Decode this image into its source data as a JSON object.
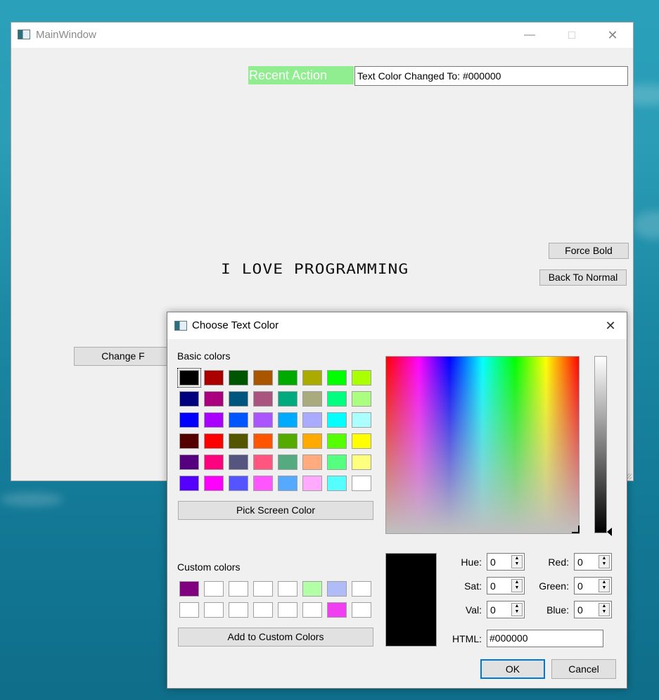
{
  "main_window": {
    "title": "MainWindow",
    "controls": {
      "minimize": "—",
      "maximize": "☐",
      "close": "✕"
    },
    "recent_action_label": "Recent Action",
    "recent_action_value": "Text Color Changed To: #000000",
    "force_bold_label": "Force Bold",
    "back_to_normal_label": "Back To Normal",
    "display_text": "I LOVE PROGRAMMING",
    "change_font_label": "Change F"
  },
  "dialog": {
    "title": "Choose Text Color",
    "close": "✕",
    "basic_colors_label": "Basic colors",
    "basic_colors": [
      "#000000",
      "#aa0000",
      "#005500",
      "#aa5500",
      "#00aa00",
      "#aaaa00",
      "#00ff00",
      "#aaff00",
      "#00007f",
      "#aa007f",
      "#00557f",
      "#aa557f",
      "#00aa7f",
      "#aaaa7f",
      "#00ff7f",
      "#aaff7f",
      "#0000ff",
      "#aa00ff",
      "#0055ff",
      "#aa55ff",
      "#00aaff",
      "#aaaaff",
      "#00ffff",
      "#aaffff",
      "#550000",
      "#ff0000",
      "#555500",
      "#ff5500",
      "#55aa00",
      "#ffaa00",
      "#55ff00",
      "#ffff00",
      "#55007f",
      "#ff007f",
      "#55557f",
      "#ff557f",
      "#55aa7f",
      "#ffaa7f",
      "#55ff7f",
      "#ffff7f",
      "#5500ff",
      "#ff00ff",
      "#5555ff",
      "#ff55ff",
      "#55aaff",
      "#ffaaff",
      "#55ffff",
      "#ffffff"
    ],
    "pick_screen_label": "Pick Screen Color",
    "custom_colors_label": "Custom colors",
    "custom_colors": [
      "#800080",
      "#ffffff",
      "#ffffff",
      "#ffffff",
      "#ffffff",
      "#b3ffa8",
      "#b0bcf8",
      "#ffffff",
      "#ffffff",
      "#ffffff",
      "#ffffff",
      "#ffffff",
      "#ffffff",
      "#ffffff",
      "#f03ff0",
      "#ffffff"
    ],
    "add_custom_label": "Add to Custom Colors",
    "fields": {
      "hue_label": "Hue:",
      "hue": "0",
      "sat_label": "Sat:",
      "sat": "0",
      "val_label": "Val:",
      "val": "0",
      "red_label": "Red:",
      "red": "0",
      "green_label": "Green:",
      "green": "0",
      "blue_label": "Blue:",
      "blue": "0",
      "html_label": "HTML:",
      "html": "#000000"
    },
    "ok_label": "OK",
    "cancel_label": "Cancel",
    "current_color": "#000000"
  }
}
